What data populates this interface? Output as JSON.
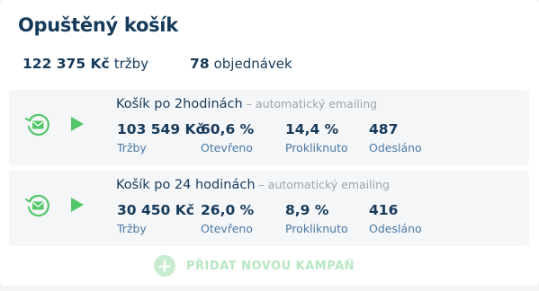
{
  "title": "Opuštěný košík",
  "summary": {
    "revenue_value": "122 375 Kč",
    "revenue_label": "tržby",
    "orders_value": "78",
    "orders_label": "objednávek"
  },
  "campaigns": [
    {
      "name": "Košík po 2hodinách",
      "subtitle": "– automatický emailing",
      "metrics": [
        {
          "value": "103 549 Kč",
          "label": "Tržby"
        },
        {
          "value": "60,6 %",
          "label": "Otevřeno"
        },
        {
          "value": "14,4 %",
          "label": "Prokliknuto"
        },
        {
          "value": "487",
          "label": "Odesláno"
        }
      ]
    },
    {
      "name": "Košík po 24 hodinách",
      "subtitle": "– automatický emailing",
      "metrics": [
        {
          "value": "30 450 Kč",
          "label": "Tržby"
        },
        {
          "value": "26,0 %",
          "label": "Otevřeno"
        },
        {
          "value": "8,9 %",
          "label": "Prokliknuto"
        },
        {
          "value": "416",
          "label": "Odesláno"
        }
      ]
    }
  ],
  "add_button": {
    "label": "PŘIDAT NOVOU KAMPAŇ",
    "icon": "plus-icon"
  },
  "icons": {
    "campaign": "auto-email-icon",
    "play": "play-icon"
  },
  "colors": {
    "accent_green": "#53c66a",
    "text_dark": "#163a5a",
    "label_blue": "#4a7aa5"
  }
}
